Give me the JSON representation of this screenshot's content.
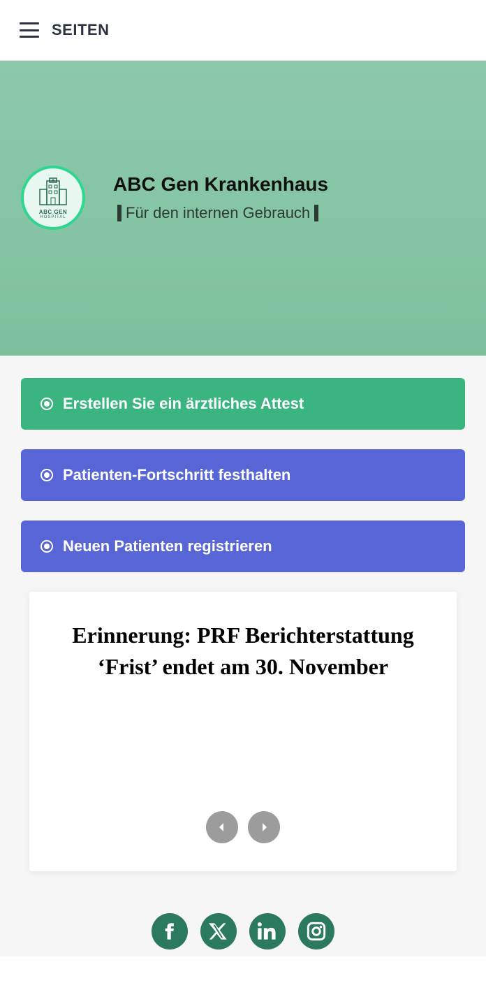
{
  "header": {
    "menu_label": "SEITEN"
  },
  "hero": {
    "title": "ABC Gen Krankenhaus",
    "subtitle": "Für den internen Gebrauch",
    "logo_label": "ABC GEN",
    "logo_sublabel": "HOSPITAL"
  },
  "actions": [
    {
      "label": "Erstellen Sie ein ärztliches Attest",
      "color": "green"
    },
    {
      "label": "Patienten-Fortschritt festhalten",
      "color": "blue"
    },
    {
      "label": "Neuen Patienten registrieren",
      "color": "blue"
    }
  ],
  "card": {
    "title": "Erinnerung: PRF Berichterstattung ‘Frist’ endet am 30. November"
  },
  "social": [
    "facebook",
    "x",
    "linkedin",
    "instagram"
  ],
  "colors": {
    "green_btn": "#3bb580",
    "blue_btn": "#5865d6",
    "hero_bg": "#85c5a3",
    "social_bg": "#2b7a5f"
  }
}
